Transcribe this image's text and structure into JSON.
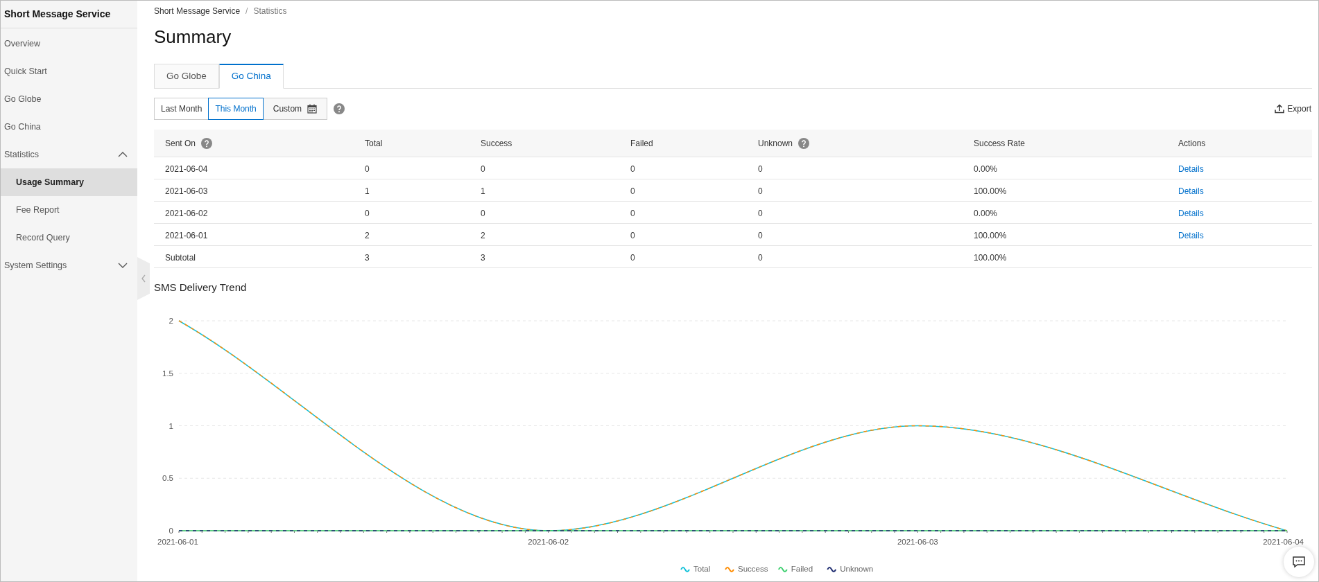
{
  "sidebar": {
    "title": "Short Message Service",
    "items": [
      {
        "label": "Overview",
        "selected": false
      },
      {
        "label": "Quick Start",
        "selected": false
      },
      {
        "label": "Go Globe",
        "selected": false
      },
      {
        "label": "Go China",
        "selected": false
      },
      {
        "label": "Statistics",
        "selected": false,
        "expanded": true,
        "children": [
          {
            "label": "Usage Summary",
            "selected": true
          },
          {
            "label": "Fee Report",
            "selected": false
          },
          {
            "label": "Record Query",
            "selected": false
          }
        ]
      },
      {
        "label": "System Settings",
        "selected": false,
        "expanded": false
      }
    ]
  },
  "breadcrumb": [
    "Short Message Service",
    "Statistics"
  ],
  "breadcrumb_separator": "/",
  "page_title": "Summary",
  "tabs": [
    {
      "label": "Go Globe",
      "selected": false
    },
    {
      "label": "Go China",
      "selected": true
    }
  ],
  "range_buttons": [
    {
      "label": "Last Month",
      "kind": "preset",
      "selected": false
    },
    {
      "label": "This Month",
      "kind": "preset",
      "selected": true
    },
    {
      "label": "Custom",
      "kind": "date_picker",
      "selected": false
    }
  ],
  "export": "Export",
  "table": {
    "columns": [
      {
        "label": "Sent On",
        "help": true
      },
      {
        "label": "Total",
        "help": false
      },
      {
        "label": "Success",
        "help": false
      },
      {
        "label": "Failed",
        "help": false
      },
      {
        "label": "Unknown",
        "help": true
      },
      {
        "label": "Success Rate",
        "help": false
      },
      {
        "label": "Actions",
        "help": false
      }
    ],
    "rows": [
      {
        "cells": [
          "2021-06-04",
          "0",
          "0",
          "0",
          "0",
          "0.00%"
        ],
        "action": "Details"
      },
      {
        "cells": [
          "2021-06-03",
          "1",
          "1",
          "0",
          "0",
          "100.00%"
        ],
        "action": "Details"
      },
      {
        "cells": [
          "2021-06-02",
          "0",
          "0",
          "0",
          "0",
          "0.00%"
        ],
        "action": "Details"
      },
      {
        "cells": [
          "2021-06-01",
          "2",
          "2",
          "0",
          "0",
          "100.00%"
        ],
        "action": "Details"
      },
      {
        "cells": [
          "Subtotal",
          "3",
          "3",
          "0",
          "0",
          "100.00%"
        ]
      }
    ]
  },
  "trend": {
    "title": "SMS Delivery Trend",
    "chart_data": {
      "type": "line",
      "grid": true,
      "legend": true,
      "categories": [
        "2021-06-01",
        "2021-06-02",
        "2021-06-03",
        "2021-06-04"
      ],
      "ylim": [
        0,
        2
      ],
      "yticks": [
        0,
        0.5,
        1,
        1.5,
        2
      ],
      "series": [
        {
          "name": "Total",
          "color": "#13c2d9",
          "values": [
            2,
            0,
            1,
            0
          ]
        },
        {
          "name": "Success",
          "color": "#ff8c00",
          "values": [
            2,
            0,
            1,
            0
          ],
          "line_style": "dashed"
        },
        {
          "name": "Failed",
          "color": "#3ccf6e",
          "values": [
            0,
            0,
            0,
            0
          ]
        },
        {
          "name": "Unknown",
          "color": "#1d2b6f",
          "values": [
            0,
            0,
            0,
            0
          ],
          "line_style": "dashed"
        }
      ]
    }
  }
}
